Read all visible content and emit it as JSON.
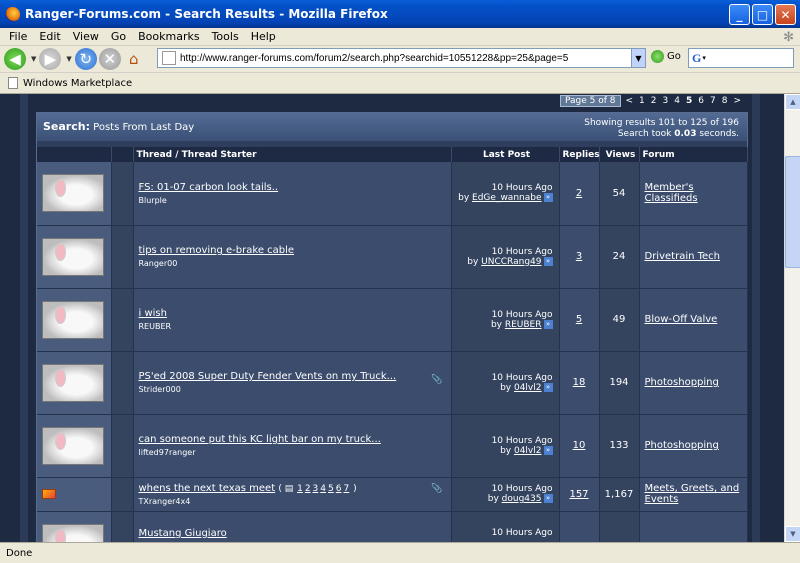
{
  "window": {
    "title": "Ranger-Forums.com - Search Results - Mozilla Firefox"
  },
  "menu": [
    "File",
    "Edit",
    "View",
    "Go",
    "Bookmarks",
    "Tools",
    "Help"
  ],
  "toolbar": {
    "url": "http://www.ranger-forums.com/forum2/search.php?searchid=10551228&pp=25&page=5",
    "go_label": "Go",
    "search_placeholder": ""
  },
  "bookmarks": [
    {
      "label": "Windows Marketplace"
    }
  ],
  "pagination": {
    "current_label": "Page 5 of 8",
    "prev": "<",
    "pages": [
      "1",
      "2",
      "3",
      "4",
      "5",
      "6",
      "7",
      "8"
    ],
    "current": "5",
    "next": ">"
  },
  "results": {
    "title_bold": "Search:",
    "title_rest": "Posts From Last Day",
    "showing": "Showing results 101 to 125 of 196",
    "took_prefix": "Search took",
    "took_value": "0.03",
    "took_suffix": "seconds.",
    "headers": {
      "thread": "Thread / Thread Starter",
      "last_post": "Last Post",
      "replies": "Replies",
      "views": "Views",
      "forum": "Forum"
    },
    "rows": [
      {
        "title": "FS: 01-07 carbon look tails..",
        "starter": "Blurple",
        "time": "10 Hours Ago",
        "by": "EdGe_wannabe",
        "replies": "2",
        "views": "54",
        "forum": "Member's Classifieds"
      },
      {
        "title": "tips on removing e-brake cable",
        "starter": "Ranger00",
        "time": "10 Hours Ago",
        "by": "UNCCRang49",
        "replies": "3",
        "views": "24",
        "forum": "Drivetrain Tech"
      },
      {
        "title": "i wish",
        "starter": "REUBER",
        "time": "10 Hours Ago",
        "by": "REUBER",
        "replies": "5",
        "views": "49",
        "forum": "Blow-Off Valve"
      },
      {
        "title": "PS'ed 2008 Super Duty Fender Vents on my Truck...",
        "starter": "Strider000",
        "time": "10 Hours Ago",
        "by": "04lvl2",
        "replies": "18",
        "views": "194",
        "forum": "Photoshopping"
      },
      {
        "title": "can someone put this KC light bar on my truck...",
        "starter": "lifted97ranger",
        "time": "10 Hours Ago",
        "by": "04lvl2",
        "replies": "10",
        "views": "133",
        "forum": "Photoshopping"
      },
      {
        "title": "whens the next texas meet",
        "starter": "TXranger4x4",
        "pages": [
          "1",
          "2",
          "3",
          "4",
          "5",
          "6",
          "7"
        ],
        "time": "10 Hours Ago",
        "by": "doug435",
        "replies": "157",
        "views": "1,167",
        "forum": "Meets, Greets, and Events"
      },
      {
        "title": "Mustang Giugiaro",
        "starter": "",
        "time": "10 Hours Ago",
        "by": "",
        "replies": "",
        "views": "",
        "forum": ""
      }
    ]
  },
  "status": {
    "text": "Done"
  }
}
